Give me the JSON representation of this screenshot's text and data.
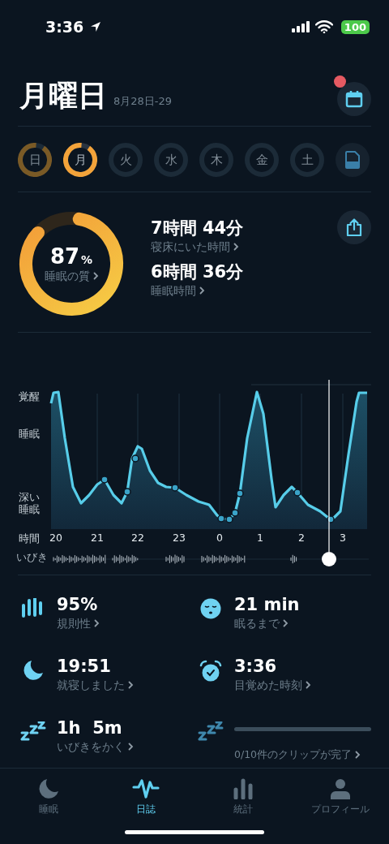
{
  "status_bar": {
    "time": "3:36",
    "battery": "100"
  },
  "header": {
    "title": "月曜日",
    "date": "8月28日-29",
    "calendar_badge": true
  },
  "days": [
    {
      "label": "日",
      "recorded": true,
      "selected": false
    },
    {
      "label": "月",
      "recorded": true,
      "selected": true
    },
    {
      "label": "火",
      "recorded": false,
      "selected": false
    },
    {
      "label": "水",
      "recorded": false,
      "selected": false
    },
    {
      "label": "木",
      "recorded": false,
      "selected": false
    },
    {
      "label": "金",
      "recorded": false,
      "selected": false
    },
    {
      "label": "土",
      "recorded": false,
      "selected": false
    }
  ],
  "summary": {
    "quality": "87",
    "quality_unit": "%",
    "quality_label": "睡眠の質",
    "rows": [
      {
        "value": "7時間 44分",
        "label": "寝床にいた時間"
      },
      {
        "value": "6時間 36分",
        "label": "睡眠時間"
      }
    ]
  },
  "chart": {
    "y_labels": [
      "覚醒",
      "睡眠",
      "深い睡眠"
    ],
    "x_title": "時間",
    "x_labels": [
      "20",
      "21",
      "22",
      "23",
      "0",
      "1",
      "2",
      "3"
    ],
    "snore_label": "いびき"
  },
  "stats": [
    {
      "kind": "stat",
      "value": "95%",
      "label": "規則性"
    },
    {
      "kind": "stat",
      "value": "21 min",
      "label": "眠るまで"
    },
    {
      "kind": "stat",
      "value": "19:51",
      "label": "就寝しました"
    },
    {
      "kind": "stat",
      "value": "3:36",
      "label": "目覚めた時刻"
    },
    {
      "kind": "stat",
      "value": "1h  5m",
      "label": "いびきをかく"
    },
    {
      "kind": "progress",
      "label": "0/10件のクリップが完了"
    }
  ],
  "tabs": [
    {
      "label": "睡眠",
      "selected": false
    },
    {
      "label": "日誌",
      "selected": true
    },
    {
      "label": "統計",
      "selected": false
    },
    {
      "label": "プロフィール",
      "selected": false
    }
  ]
}
